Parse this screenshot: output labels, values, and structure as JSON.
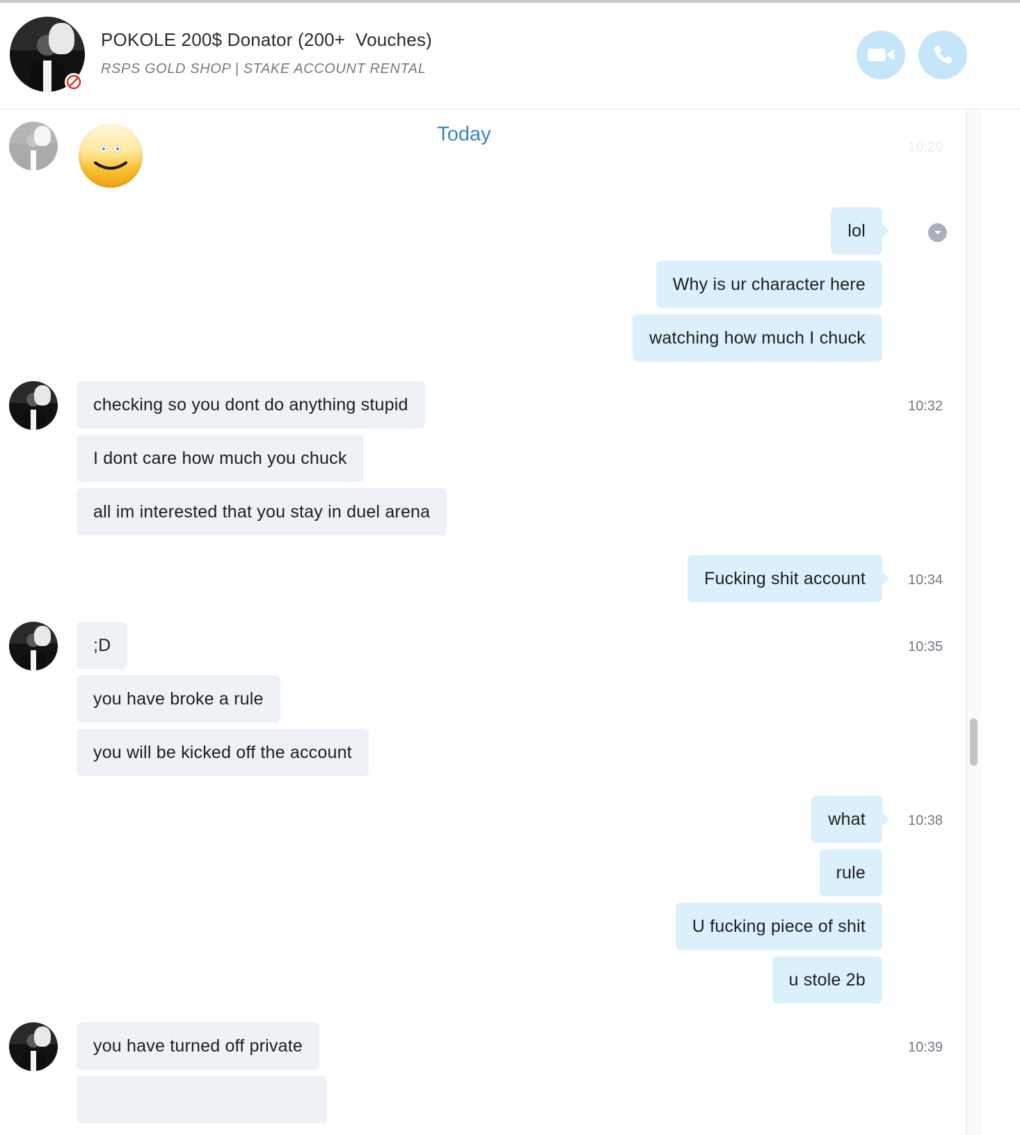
{
  "header": {
    "title": "POKOLE 200$ Donator (200+  Vouches)",
    "subtitle": "RSPS GOLD SHOP | STAKE ACCOUNT RENTAL",
    "video_icon": "video-camera-icon",
    "call_icon": "phone-icon",
    "status_icon": "blocked-icon"
  },
  "chat": {
    "date_divider": "Today",
    "first_time": "10:29",
    "emoji_icon": "smiley-emoji",
    "groups": [
      {
        "sender": "contact",
        "time": "10:32",
        "messages": [
          "checking so you dont do anything stupid",
          "I dont care how much you chuck",
          "all im interested that you stay in duel arena"
        ]
      },
      {
        "sender": "me",
        "time": "10:34",
        "messages": [
          "Fucking shit account"
        ]
      },
      {
        "sender": "contact",
        "time": "10:35",
        "messages": [
          ";D",
          "you have broke a rule",
          "you will be kicked off the account"
        ]
      },
      {
        "sender": "me",
        "time": "10:38",
        "messages": [
          "what",
          "rule",
          "U fucking piece of shit",
          "u stole 2b"
        ]
      },
      {
        "sender": "contact",
        "time": "10:39",
        "messages": [
          "you have turned off private"
        ]
      }
    ],
    "outgoing_first": [
      "lol",
      "Why is ur character here",
      "watching how much I chuck"
    ]
  },
  "colors": {
    "incoming_bubble": "#eef1f5",
    "outgoing_bubble": "#dcf0fc",
    "accent": "#3a86b8",
    "call_button": "#c5e6f8"
  }
}
